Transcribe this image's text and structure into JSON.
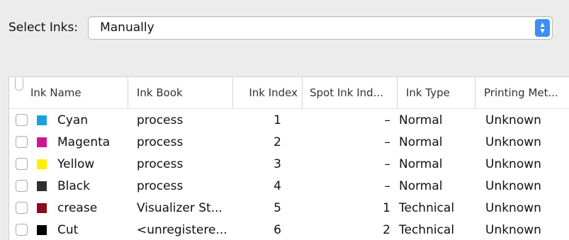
{
  "select_inks": {
    "label": "Select Inks:",
    "value": "Manually"
  },
  "table": {
    "columns": [
      "Ink Name",
      "Ink Book",
      "Ink Index",
      "Spot Ink Ind...",
      "Ink Type",
      "Printing Met..."
    ],
    "rows": [
      {
        "checked": false,
        "color": "#1aa0e0",
        "name": "Cyan",
        "book": "process",
        "index": "1",
        "spot": "–",
        "type": "Normal",
        "method": "Unknown"
      },
      {
        "checked": false,
        "color": "#d0168f",
        "name": "Magenta",
        "book": "process",
        "index": "2",
        "spot": "–",
        "type": "Normal",
        "method": "Unknown"
      },
      {
        "checked": false,
        "color": "#ffee00",
        "name": "Yellow",
        "book": "process",
        "index": "3",
        "spot": "–",
        "type": "Normal",
        "method": "Unknown"
      },
      {
        "checked": false,
        "color": "#2f3030",
        "name": "Black",
        "book": "process",
        "index": "4",
        "spot": "–",
        "type": "Normal",
        "method": "Unknown"
      },
      {
        "checked": false,
        "color": "#8b0a20",
        "name": "crease",
        "book": "Visualizer St...",
        "index": "5",
        "spot": "1",
        "type": "Technical",
        "method": "Unknown"
      },
      {
        "checked": false,
        "color": "#000000",
        "name": "Cut",
        "book": "<unregistere...",
        "index": "6",
        "spot": "2",
        "type": "Technical",
        "method": "Unknown"
      }
    ]
  },
  "colors": {
    "stepper_accent": "#3b8ff3"
  }
}
